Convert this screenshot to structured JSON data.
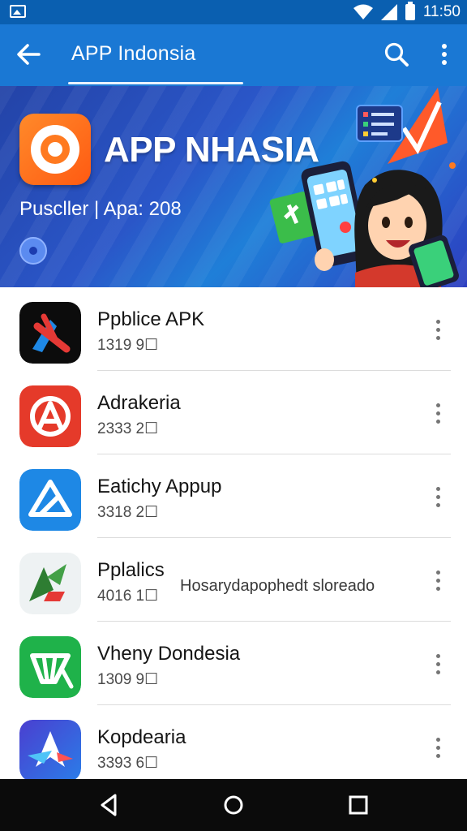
{
  "status_bar": {
    "time": "11:50"
  },
  "app_bar": {
    "title": "APP Indonsia"
  },
  "banner": {
    "headline": "APP NHASIA",
    "subline": "Puscller |  Apa: 208"
  },
  "apps": [
    {
      "name": "Ppblice APK",
      "meta": "1319 9☐"
    },
    {
      "name": "Adrakeria",
      "meta": "2333 2☐"
    },
    {
      "name": "Eatichy Appup",
      "meta": "3318 2☐"
    },
    {
      "name": "Pplalics",
      "meta": "4016 1☐",
      "extra": "Hosarydapophedt sloreado"
    },
    {
      "name": "Vheny Dondesia",
      "meta": "1309 9☐"
    },
    {
      "name": "Kopdearia",
      "meta": "3393 6☐"
    }
  ],
  "colors": {
    "status_bar": "#0a5fb0",
    "app_bar": "#1a78d4",
    "accent": "#ff7a20"
  },
  "icons": [
    "image-icon",
    "wifi-icon",
    "signal-icon",
    "battery-icon",
    "back-arrow-icon",
    "search-icon",
    "more-vert-icon",
    "back-nav-icon",
    "home-nav-icon",
    "recents-nav-icon"
  ]
}
